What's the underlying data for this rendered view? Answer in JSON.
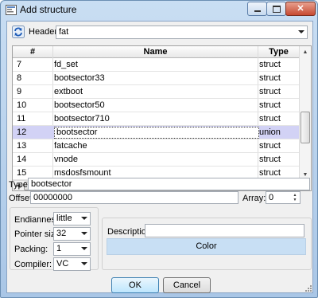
{
  "window": {
    "title": "Add structure"
  },
  "header": {
    "label": "Header:",
    "value": "fat"
  },
  "table": {
    "columns": [
      "#",
      "Name",
      "Type"
    ],
    "rows": [
      {
        "num": "7",
        "name": "fd_set",
        "type": "struct"
      },
      {
        "num": "8",
        "name": "bootsector33",
        "type": "struct"
      },
      {
        "num": "9",
        "name": "extboot",
        "type": "struct"
      },
      {
        "num": "10",
        "name": "bootsector50",
        "type": "struct"
      },
      {
        "num": "11",
        "name": "bootsector710",
        "type": "struct"
      },
      {
        "num": "12",
        "name": "bootsector",
        "type": "union"
      },
      {
        "num": "13",
        "name": "fatcache",
        "type": "struct"
      },
      {
        "num": "14",
        "name": "vnode",
        "type": "struct"
      },
      {
        "num": "15",
        "name": "msdosfsmount",
        "type": "struct"
      }
    ],
    "selected_index": 5
  },
  "type_field": {
    "label": "Type:",
    "value": "bootsector"
  },
  "offset_field": {
    "label": "Offset:",
    "value": "00000000"
  },
  "array_field": {
    "label": "Array:",
    "value": "0"
  },
  "options": {
    "endianness": {
      "label": "Endianness:",
      "value": "little"
    },
    "pointer_size": {
      "label": "Pointer size:",
      "value": "32"
    },
    "packing": {
      "label": "Packing:",
      "value": "1"
    },
    "compiler": {
      "label": "Compiler:",
      "value": "VC"
    }
  },
  "description": {
    "label": "Description:",
    "value": ""
  },
  "color_button": {
    "label": "Color",
    "color": "#c8dff4"
  },
  "buttons": {
    "ok": "OK",
    "cancel": "Cancel"
  }
}
